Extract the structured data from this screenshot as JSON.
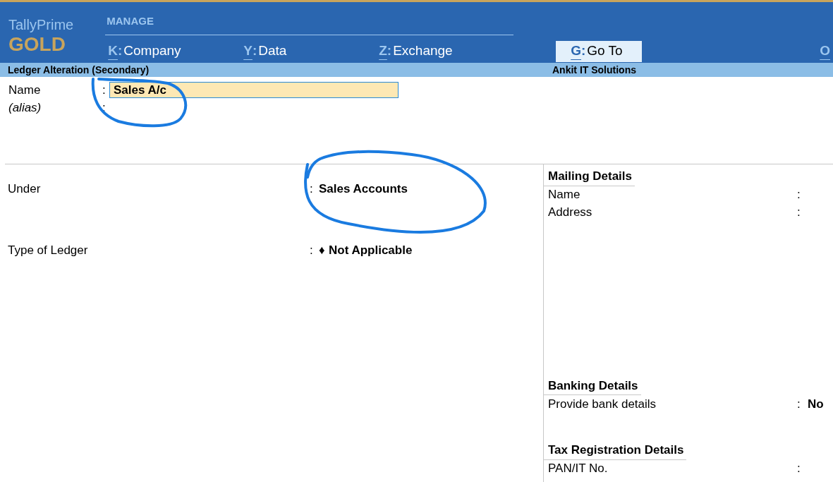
{
  "brand": {
    "product": "TallyPrime",
    "edition": "GOLD"
  },
  "menu": {
    "section": "MANAGE",
    "items": [
      {
        "key": "K",
        "sep": ":",
        "label": "Company",
        "selected": false
      },
      {
        "key": "Y",
        "sep": ":",
        "label": "Data",
        "selected": false
      },
      {
        "key": "Z",
        "sep": ":",
        "label": "Exchange",
        "selected": false
      },
      {
        "key": "G",
        "sep": ":",
        "label": "Go To",
        "selected": true
      },
      {
        "key": "O",
        "selected": false
      }
    ]
  },
  "title_bar": {
    "screen": "Ledger Alteration (Secondary)",
    "company": "Ankit IT Solutions"
  },
  "name_fields": [
    {
      "label": "Name",
      "sep": ":",
      "value": "Sales A/c",
      "italic": false
    },
    {
      "label": "(alias)",
      "sep": ":",
      "italic": true
    }
  ],
  "left_fields": [
    {
      "label": "Under",
      "sep": ":",
      "value": "Sales Accounts"
    },
    {
      "label": "Type of Ledger",
      "sep": ":",
      "value": "Not Applicable",
      "bullet": "♦"
    }
  ],
  "right_sections": [
    {
      "heading": "Mailing Details",
      "rows": [
        {
          "label": "Name",
          "sep": ":",
          "value": ""
        },
        {
          "label": "Address",
          "sep": ":",
          "value": ""
        }
      ]
    },
    {
      "heading": "Banking Details",
      "rows": [
        {
          "label": "Provide bank details",
          "sep": ":",
          "value": "No"
        }
      ]
    },
    {
      "heading": "Tax Registration Details",
      "rows": [
        {
          "label": "PAN/IT No.",
          "sep": ":",
          "value": ""
        }
      ]
    }
  ]
}
